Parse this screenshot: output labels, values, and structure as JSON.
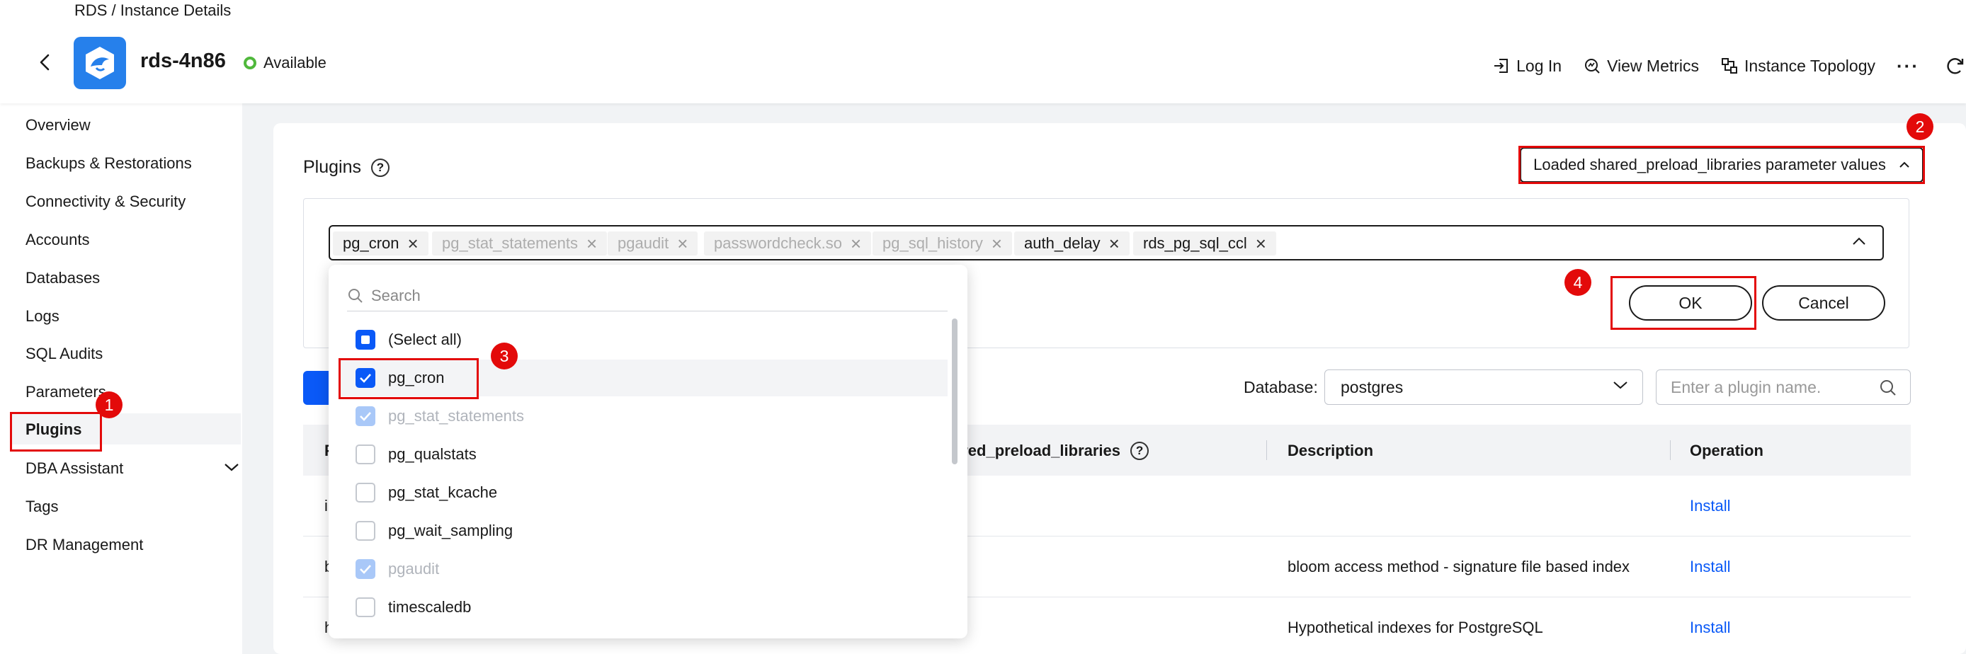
{
  "breadcrumb": "RDS / Instance Details",
  "instance": {
    "name": "rds-4n86",
    "status": "Available"
  },
  "top_actions": {
    "login": "Log In",
    "metrics": "View Metrics",
    "topology": "Instance Topology",
    "more": "···"
  },
  "sidebar": {
    "items": [
      {
        "label": "Overview"
      },
      {
        "label": "Backups & Restorations"
      },
      {
        "label": "Connectivity & Security"
      },
      {
        "label": "Accounts"
      },
      {
        "label": "Databases"
      },
      {
        "label": "Logs"
      },
      {
        "label": "SQL Audits"
      },
      {
        "label": "Parameters"
      },
      {
        "label": "Plugins"
      },
      {
        "label": "DBA Assistant"
      },
      {
        "label": "Tags"
      },
      {
        "label": "DR Management"
      }
    ],
    "active": "Plugins"
  },
  "plugins": {
    "title": "Plugins",
    "help": "?",
    "param_button": "Loaded shared_preload_libraries parameter values",
    "tags": [
      {
        "label": "pg_cron",
        "disabled": false
      },
      {
        "label": "pg_stat_statements",
        "disabled": true
      },
      {
        "label": "pgaudit",
        "disabled": true
      },
      {
        "label": "passwordcheck.so",
        "disabled": true
      },
      {
        "label": "pg_sql_history",
        "disabled": true
      },
      {
        "label": "auth_delay",
        "disabled": false
      },
      {
        "label": "rds_pg_sql_ccl",
        "disabled": false
      }
    ],
    "ok": "OK",
    "cancel": "Cancel"
  },
  "dropdown": {
    "search_placeholder": "Search",
    "options": [
      {
        "label": "(Select all)",
        "state": "indeterminate"
      },
      {
        "label": "pg_cron",
        "state": "checked"
      },
      {
        "label": "pg_stat_statements",
        "state": "checked-disabled"
      },
      {
        "label": "pg_qualstats",
        "state": "unchecked"
      },
      {
        "label": "pg_stat_kcache",
        "state": "unchecked"
      },
      {
        "label": "pg_wait_sampling",
        "state": "unchecked"
      },
      {
        "label": "pgaudit",
        "state": "checked-disabled"
      },
      {
        "label": "timescaledb",
        "state": "unchecked"
      }
    ]
  },
  "filter": {
    "database_label": "Database:",
    "database_value": "postgres",
    "search_placeholder": "Enter a plugin name."
  },
  "table": {
    "columns": {
      "first": "P",
      "shared": "ared_preload_libraries",
      "description": "Description",
      "operation": "Operation"
    },
    "rows": [
      {
        "name": "i",
        "description": "",
        "operation": "Install"
      },
      {
        "name": "b",
        "description": "bloom access method - signature file based index",
        "operation": "Install"
      },
      {
        "name": "h",
        "description": "Hypothetical indexes for PostgreSQL",
        "operation": "Install"
      }
    ]
  },
  "annotations": {
    "badge1": "1",
    "badge2": "2",
    "badge3": "3",
    "badge4": "4"
  },
  "colors": {
    "accent": "#0a59f7",
    "annotation": "#e30a0a",
    "status": "#50b83c",
    "logo": "#2680eb"
  }
}
